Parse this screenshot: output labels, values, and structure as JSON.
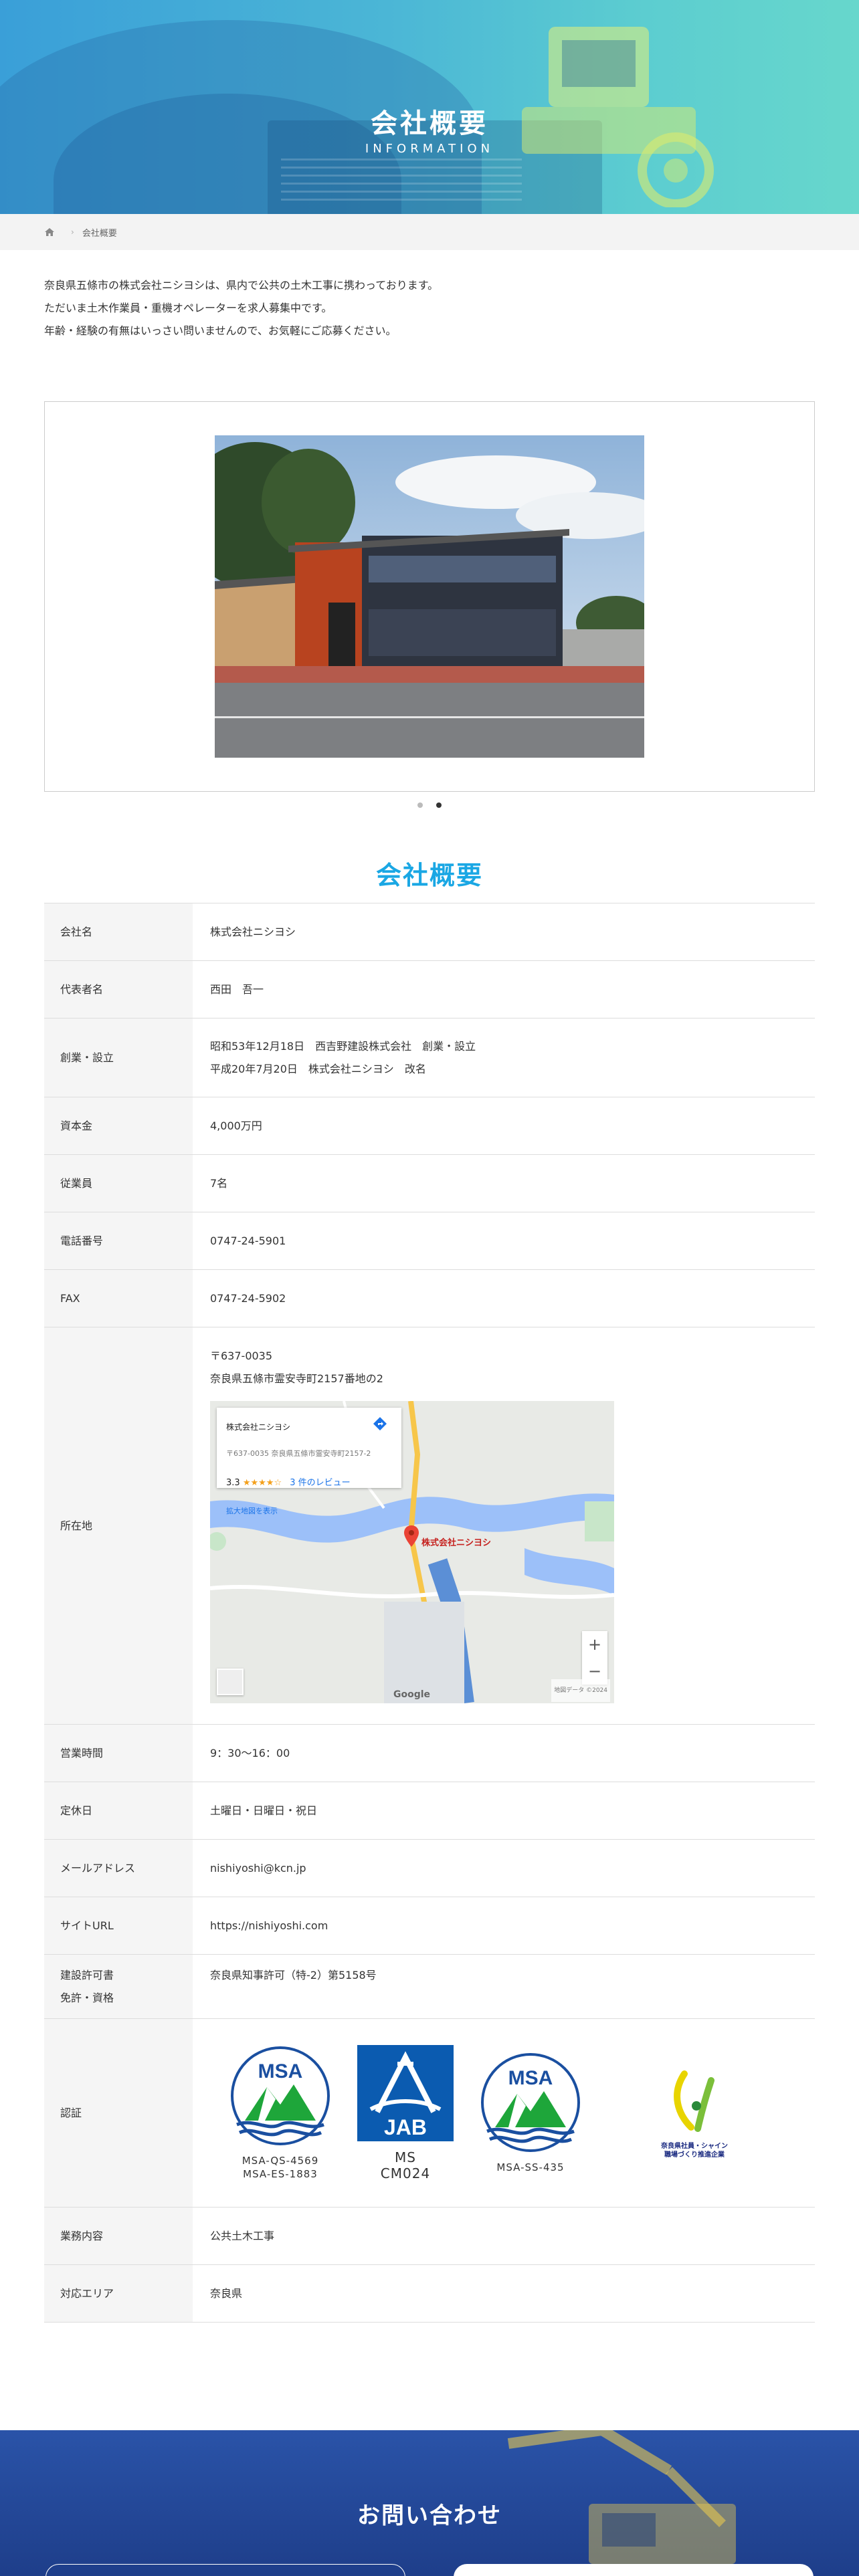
{
  "hero": {
    "title": "会社概要",
    "subtitle": "INFORMATION"
  },
  "breadcrumb": {
    "current": "会社概要"
  },
  "intro": [
    "奈良県五條市の株式会社ニシヨシは、県内で公共の土木工事に携わっております。",
    "ただいま土木作業員・重機オペレーターを求人募集中です。",
    "年齢・経験の有無はいっさい問いませんので、お気軽にご応募ください。"
  ],
  "slider": {
    "total": 2,
    "active": 2
  },
  "section_title": "会社概要",
  "table": {
    "company_name": {
      "label": "会社名",
      "value": "株式会社ニシヨシ"
    },
    "representative": {
      "label": "代表者名",
      "value": "西田　吾一"
    },
    "founded": {
      "label": "創業・設立",
      "line1": "昭和53年12月18日　西吉野建設株式会社　創業・設立",
      "line2": "平成20年7月20日　株式会社ニシヨシ　改名"
    },
    "capital": {
      "label": "資本金",
      "value": "4,000万円"
    },
    "employees": {
      "label": "従業員",
      "value": "7名"
    },
    "phone": {
      "label": "電話番号",
      "value": "0747-24-5901"
    },
    "fax": {
      "label": "FAX",
      "value": "0747-24-5902"
    },
    "address": {
      "label": "所在地",
      "postal": "〒637-0035",
      "line": "奈良県五條市霊安寺町2157番地の2"
    },
    "hours": {
      "label": "営業時間",
      "value": "9：30〜16：00"
    },
    "holidays": {
      "label": "定休日",
      "value": "土曜日・日曜日・祝日"
    },
    "email": {
      "label": "メールアドレス",
      "value": "nishiyoshi@kcn.jp"
    },
    "site": {
      "label": "サイトURL",
      "value": "https://nishiyoshi.com"
    },
    "license": {
      "label1": "建設許可書",
      "label2": "免許・資格",
      "value": "奈良県知事許可（特-2）第5158号"
    },
    "certification": {
      "label": "認証"
    },
    "business": {
      "label": "業務内容",
      "value": "公共土木工事"
    },
    "area": {
      "label": "対応エリア",
      "value": "奈良県"
    }
  },
  "map": {
    "card_name": "株式会社ニシヨシ",
    "card_address": "〒637-0035 奈良県五條市霊安寺町2157-2",
    "rating": "3.3",
    "stars": "★★★★☆",
    "reviews": "3 件のレビュー",
    "larger_map": "拡大地図を表示",
    "pin_label": "株式会社ニシヨシ",
    "zoom_in": "+",
    "zoom_out": "−",
    "google": "Google",
    "footer": "地図データ ©2024"
  },
  "certs": {
    "msa1_caption1": "MSA-QS-4569",
    "msa1_caption2": "MSA-ES-1883",
    "jab_caption1": "MS",
    "jab_caption2": "CM024",
    "msa2_caption": "MSA-SS-435",
    "msa_logo_text": "MSA",
    "jab_logo_text": "JAB",
    "shine_caption1": "奈良県社員・シャイン",
    "shine_caption2": "職場づくり推進企業"
  },
  "contact": {
    "title": "お問い合わせ"
  },
  "colors": {
    "accent": "#1aa7e4",
    "hero": "#4bb6d6",
    "contact": "#2a53a8"
  }
}
